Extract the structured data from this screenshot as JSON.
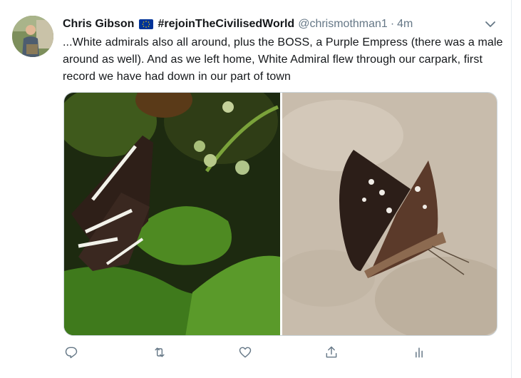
{
  "tweet": {
    "author_name": "Chris Gibson",
    "flag_icon": "eu-flag",
    "display_hashtag": "#rejoinTheCivilisedWorld",
    "handle": "@chrismothman1",
    "separator": "·",
    "time": "4m",
    "text": "...White admirals also all around, plus the BOSS, a Purple Empress (there was a male around as well). And as we left home, White Admiral flew through our carpark, first record we have had down in our part of town"
  },
  "media": {
    "photos": [
      {
        "subject": "white-admiral-butterfly"
      },
      {
        "subject": "purple-emperor-butterfly"
      }
    ]
  },
  "actions": [
    {
      "icon": "reply-icon"
    },
    {
      "icon": "retweet-icon"
    },
    {
      "icon": "like-icon"
    },
    {
      "icon": "share-icon"
    },
    {
      "icon": "analytics-icon"
    }
  ],
  "colors": {
    "text": "#14171a",
    "secondary": "#657786",
    "icon": "#657786",
    "divider": "#e6ecf0",
    "eu_blue": "#003399",
    "eu_gold": "#ffcc00"
  }
}
